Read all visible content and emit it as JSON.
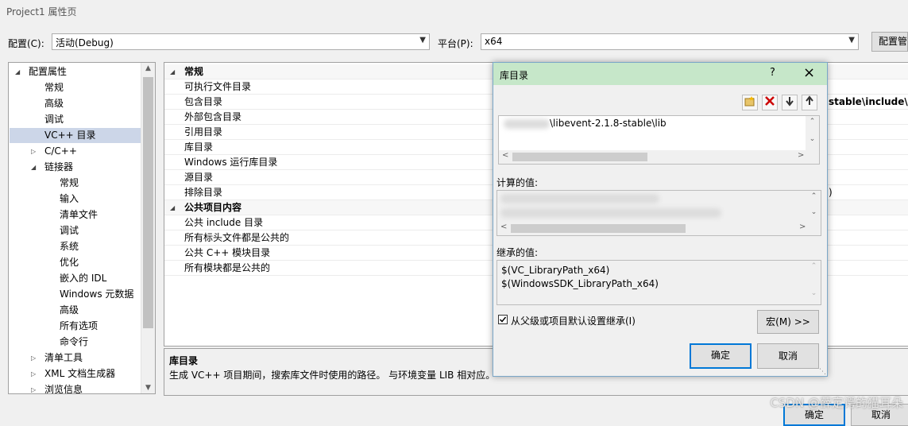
{
  "window_title": "Project1 属性页",
  "config": {
    "label": "配置(C):",
    "value": "活动(Debug)"
  },
  "platform": {
    "label": "平台(P):",
    "value": "x64"
  },
  "config_manager_button": "配置管",
  "tree": {
    "items": [
      {
        "label": "配置属性",
        "level": 0,
        "toggle": "expanded"
      },
      {
        "label": "常规",
        "level": 1
      },
      {
        "label": "高级",
        "level": 1
      },
      {
        "label": "调试",
        "level": 1
      },
      {
        "label": "VC++ 目录",
        "level": 1,
        "selected": true
      },
      {
        "label": "C/C++",
        "level": 1,
        "toggle": "collapsed"
      },
      {
        "label": "链接器",
        "level": 1,
        "toggle": "expanded"
      },
      {
        "label": "常规",
        "level": 2
      },
      {
        "label": "输入",
        "level": 2
      },
      {
        "label": "清单文件",
        "level": 2
      },
      {
        "label": "调试",
        "level": 2
      },
      {
        "label": "系统",
        "level": 2
      },
      {
        "label": "优化",
        "level": 2
      },
      {
        "label": "嵌入的 IDL",
        "level": 2
      },
      {
        "label": "Windows 元数据",
        "level": 2
      },
      {
        "label": "高级",
        "level": 2
      },
      {
        "label": "所有选项",
        "level": 2
      },
      {
        "label": "命令行",
        "level": 2
      },
      {
        "label": "清单工具",
        "level": 1,
        "toggle": "collapsed"
      },
      {
        "label": "XML 文档生成器",
        "level": 1,
        "toggle": "collapsed"
      },
      {
        "label": "浏览信息",
        "level": 1,
        "toggle": "collapsed"
      }
    ]
  },
  "grid": {
    "rows": [
      {
        "name": "常规",
        "category": true
      },
      {
        "name": "可执行文件目录"
      },
      {
        "name": "包含目录",
        "value": "stable\\include\\e"
      },
      {
        "name": "外部包含目录"
      },
      {
        "name": "引用目录"
      },
      {
        "name": "库目录"
      },
      {
        "name": "Windows 运行库目录"
      },
      {
        "name": "源目录"
      },
      {
        "name": "排除目录",
        "value": ")"
      },
      {
        "name": "公共项目内容",
        "category": true
      },
      {
        "name": "公共 include 目录"
      },
      {
        "name": "所有标头文件都是公共的"
      },
      {
        "name": "公共 C++ 模块目录"
      },
      {
        "name": "所有模块都是公共的"
      }
    ]
  },
  "description": {
    "title": "库目录",
    "text": "生成 VC++ 项目期间，搜索库文件时使用的路径。 与环境变量 LIB 相对应。"
  },
  "dialog": {
    "title": "库目录",
    "help": "?",
    "close": "×",
    "path_line": "\\libevent-2.1.8-stable\\lib",
    "computed_label": "计算的值:",
    "inherited_label": "继承的值:",
    "inherited_values": [
      "$(VC_LibraryPath_x64)",
      "$(WindowsSDK_LibraryPath_x64)"
    ],
    "inherit_checkbox": "从父级或项目默认设置继承(I)",
    "macros_button": "宏(M) >>",
    "ok_button": "确定",
    "cancel_button": "取消"
  },
  "bottom": {
    "ok_button": "确定",
    "cancel_button": "取消"
  },
  "watermark": "CSDN @薛定谔的猫耳朵",
  "colors": {
    "dialog_title_bg": "#c6e7c9",
    "selection": "#ccd6e8",
    "primary_border": "#0078d7",
    "delete_icon": "#cc0000"
  }
}
